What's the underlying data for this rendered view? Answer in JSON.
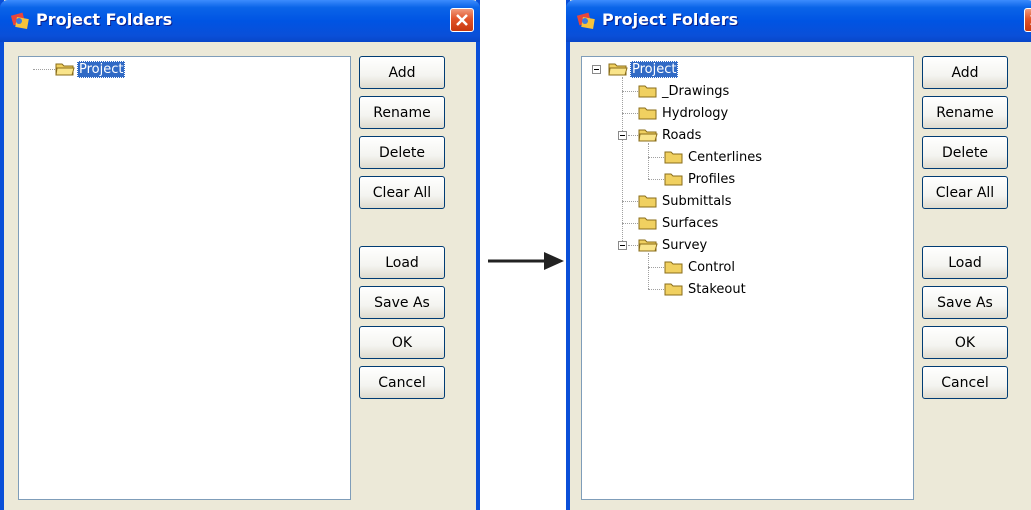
{
  "left_dialog": {
    "title": "Project Folders",
    "tree": {
      "root": "Project"
    },
    "buttons": {
      "add": "Add",
      "rename": "Rename",
      "delete": "Delete",
      "clear_all": "Clear All",
      "load": "Load",
      "save_as": "Save As",
      "ok": "OK",
      "cancel": "Cancel"
    }
  },
  "right_dialog": {
    "title": "Project Folders",
    "tree": {
      "root": "Project",
      "drawings": "_Drawings",
      "hydrology": "Hydrology",
      "roads": "Roads",
      "centerlines": "Centerlines",
      "profiles": "Profiles",
      "submittals": "Submittals",
      "surfaces": "Surfaces",
      "survey": "Survey",
      "control": "Control",
      "stakeout": "Stakeout"
    },
    "buttons": {
      "add": "Add",
      "rename": "Rename",
      "delete": "Delete",
      "clear_all": "Clear All",
      "load": "Load",
      "save_as": "Save As",
      "ok": "OK",
      "cancel": "Cancel"
    }
  },
  "icons": {
    "app": "project-folders-app-icon",
    "close": "close-icon",
    "folder": "folder-icon",
    "arrow": "arrow-right-icon"
  },
  "colors": {
    "titlebar": "#0054e3",
    "selection": "#316ac5",
    "dialog_bg": "#ece9d8",
    "close_button": "#e1542a"
  }
}
